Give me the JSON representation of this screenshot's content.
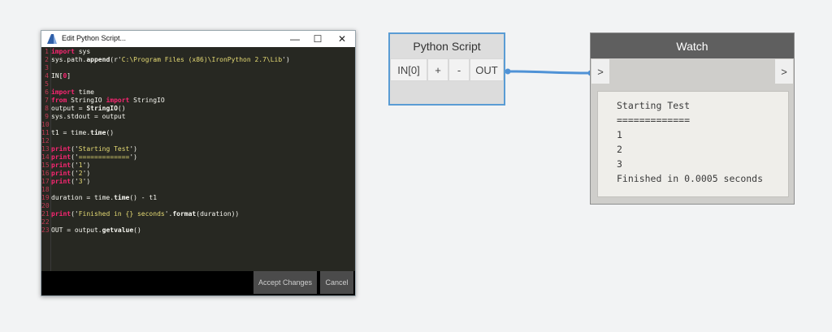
{
  "editor": {
    "title": "Edit Python Script...",
    "controls": {
      "minimize": "—",
      "maximize": "☐",
      "close": "✕"
    },
    "lines": [
      {
        "n": "1",
        "parts": [
          {
            "t": "import",
            "c": "kw"
          },
          {
            "t": " sys",
            "c": "txt"
          }
        ]
      },
      {
        "n": "2",
        "parts": [
          {
            "t": "sys.path.",
            "c": "txt"
          },
          {
            "t": "append",
            "c": "fn"
          },
          {
            "t": "(r'",
            "c": "txt"
          },
          {
            "t": "C:\\Program Files (x86)\\IronPython 2.7\\Lib",
            "c": "str"
          },
          {
            "t": "')",
            "c": "txt"
          }
        ]
      },
      {
        "n": "3",
        "parts": []
      },
      {
        "n": "4",
        "parts": [
          {
            "t": "IN[",
            "c": "txt"
          },
          {
            "t": "0",
            "c": "kw"
          },
          {
            "t": "]",
            "c": "txt"
          }
        ]
      },
      {
        "n": "5",
        "parts": []
      },
      {
        "n": "6",
        "parts": [
          {
            "t": "import",
            "c": "kw"
          },
          {
            "t": " time",
            "c": "txt"
          }
        ]
      },
      {
        "n": "7",
        "parts": [
          {
            "t": "from",
            "c": "kw"
          },
          {
            "t": " StringIO ",
            "c": "txt"
          },
          {
            "t": "import",
            "c": "kw"
          },
          {
            "t": " StringIO",
            "c": "txt"
          }
        ]
      },
      {
        "n": "8",
        "parts": [
          {
            "t": "output = ",
            "c": "txt"
          },
          {
            "t": "StringIO",
            "c": "fn"
          },
          {
            "t": "()",
            "c": "txt"
          }
        ]
      },
      {
        "n": "9",
        "parts": [
          {
            "t": "sys.stdout = output",
            "c": "txt"
          }
        ]
      },
      {
        "n": "10",
        "parts": []
      },
      {
        "n": "11",
        "parts": [
          {
            "t": "t1 = time.",
            "c": "txt"
          },
          {
            "t": "time",
            "c": "fn"
          },
          {
            "t": "()",
            "c": "txt"
          }
        ]
      },
      {
        "n": "12",
        "parts": []
      },
      {
        "n": "13",
        "parts": [
          {
            "t": "print",
            "c": "kw"
          },
          {
            "t": "('",
            "c": "txt"
          },
          {
            "t": "Starting Test",
            "c": "str"
          },
          {
            "t": "')",
            "c": "txt"
          }
        ]
      },
      {
        "n": "14",
        "parts": [
          {
            "t": "print",
            "c": "kw"
          },
          {
            "t": "('",
            "c": "txt"
          },
          {
            "t": "=============",
            "c": "str"
          },
          {
            "t": "')",
            "c": "txt"
          }
        ]
      },
      {
        "n": "15",
        "parts": [
          {
            "t": "print",
            "c": "kw"
          },
          {
            "t": "('",
            "c": "txt"
          },
          {
            "t": "1",
            "c": "str"
          },
          {
            "t": "')",
            "c": "txt"
          }
        ]
      },
      {
        "n": "16",
        "parts": [
          {
            "t": "print",
            "c": "kw"
          },
          {
            "t": "('",
            "c": "txt"
          },
          {
            "t": "2",
            "c": "str"
          },
          {
            "t": "')",
            "c": "txt"
          }
        ]
      },
      {
        "n": "17",
        "parts": [
          {
            "t": "print",
            "c": "kw"
          },
          {
            "t": "('",
            "c": "txt"
          },
          {
            "t": "3",
            "c": "str"
          },
          {
            "t": "')",
            "c": "txt"
          }
        ]
      },
      {
        "n": "18",
        "parts": []
      },
      {
        "n": "19",
        "parts": [
          {
            "t": "duration = time.",
            "c": "txt"
          },
          {
            "t": "time",
            "c": "fn"
          },
          {
            "t": "() - t1",
            "c": "txt"
          }
        ]
      },
      {
        "n": "20",
        "parts": []
      },
      {
        "n": "21",
        "parts": [
          {
            "t": "print",
            "c": "kw"
          },
          {
            "t": "('",
            "c": "txt"
          },
          {
            "t": "Finished in {} seconds",
            "c": "str"
          },
          {
            "t": "'.",
            "c": "txt"
          },
          {
            "t": "format",
            "c": "fn"
          },
          {
            "t": "(duration))",
            "c": "txt"
          }
        ]
      },
      {
        "n": "22",
        "parts": []
      },
      {
        "n": "23",
        "parts": [
          {
            "t": "OUT = output.",
            "c": "txt"
          },
          {
            "t": "getvalue",
            "c": "fn"
          },
          {
            "t": "()",
            "c": "txt"
          }
        ]
      }
    ],
    "accept_label": "Accept Changes",
    "cancel_label": "Cancel"
  },
  "python_node": {
    "title": "Python Script",
    "in_port": "IN[0]",
    "add_label": "+",
    "remove_label": "-",
    "out_port": "OUT"
  },
  "watch_node": {
    "title": "Watch",
    "in_port": ">",
    "out_port": ">",
    "output_lines": [
      "Starting Test",
      "=============",
      "1",
      "2",
      "3",
      "Finished in 0.0005 seconds"
    ]
  },
  "colors": {
    "wire": "#4f92d6",
    "selection_border": "#5a9cd4",
    "editor_bg": "#272822",
    "keyword": "#f92672",
    "string": "#e6db74"
  }
}
